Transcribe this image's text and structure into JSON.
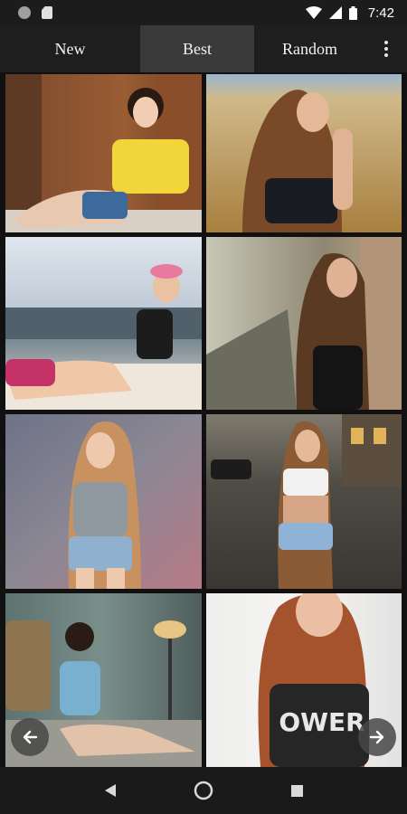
{
  "status_bar": {
    "time": "7:42",
    "icons": [
      "notification-dot-icon",
      "sd-card-icon",
      "wifi-icon",
      "signal-icon",
      "battery-icon"
    ]
  },
  "tabs": [
    {
      "label": "New",
      "active": false
    },
    {
      "label": "Best",
      "active": true
    },
    {
      "label": "Random",
      "active": false
    }
  ],
  "menu": {
    "icon": "more-vertical-icon"
  },
  "gallery": {
    "photos": [
      {
        "description": "photo-1",
        "shirt_text": ""
      },
      {
        "description": "photo-2",
        "shirt_text": ""
      },
      {
        "description": "photo-3",
        "shirt_text": ""
      },
      {
        "description": "photo-4",
        "shirt_text": ""
      },
      {
        "description": "photo-5",
        "shirt_text": ""
      },
      {
        "description": "photo-6",
        "shirt_text": ""
      },
      {
        "description": "photo-7",
        "shirt_text": ""
      },
      {
        "description": "photo-8",
        "shirt_text": "OWER"
      }
    ]
  },
  "pager": {
    "prev_icon": "arrow-left-icon",
    "next_icon": "arrow-right-icon"
  },
  "nav_bar": {
    "icons": [
      "back-triangle-icon",
      "home-circle-icon",
      "recents-square-icon"
    ]
  },
  "colors": {
    "active_tab": "#3a3a3a",
    "bar": "#1e1e1e",
    "background": "#111111"
  }
}
